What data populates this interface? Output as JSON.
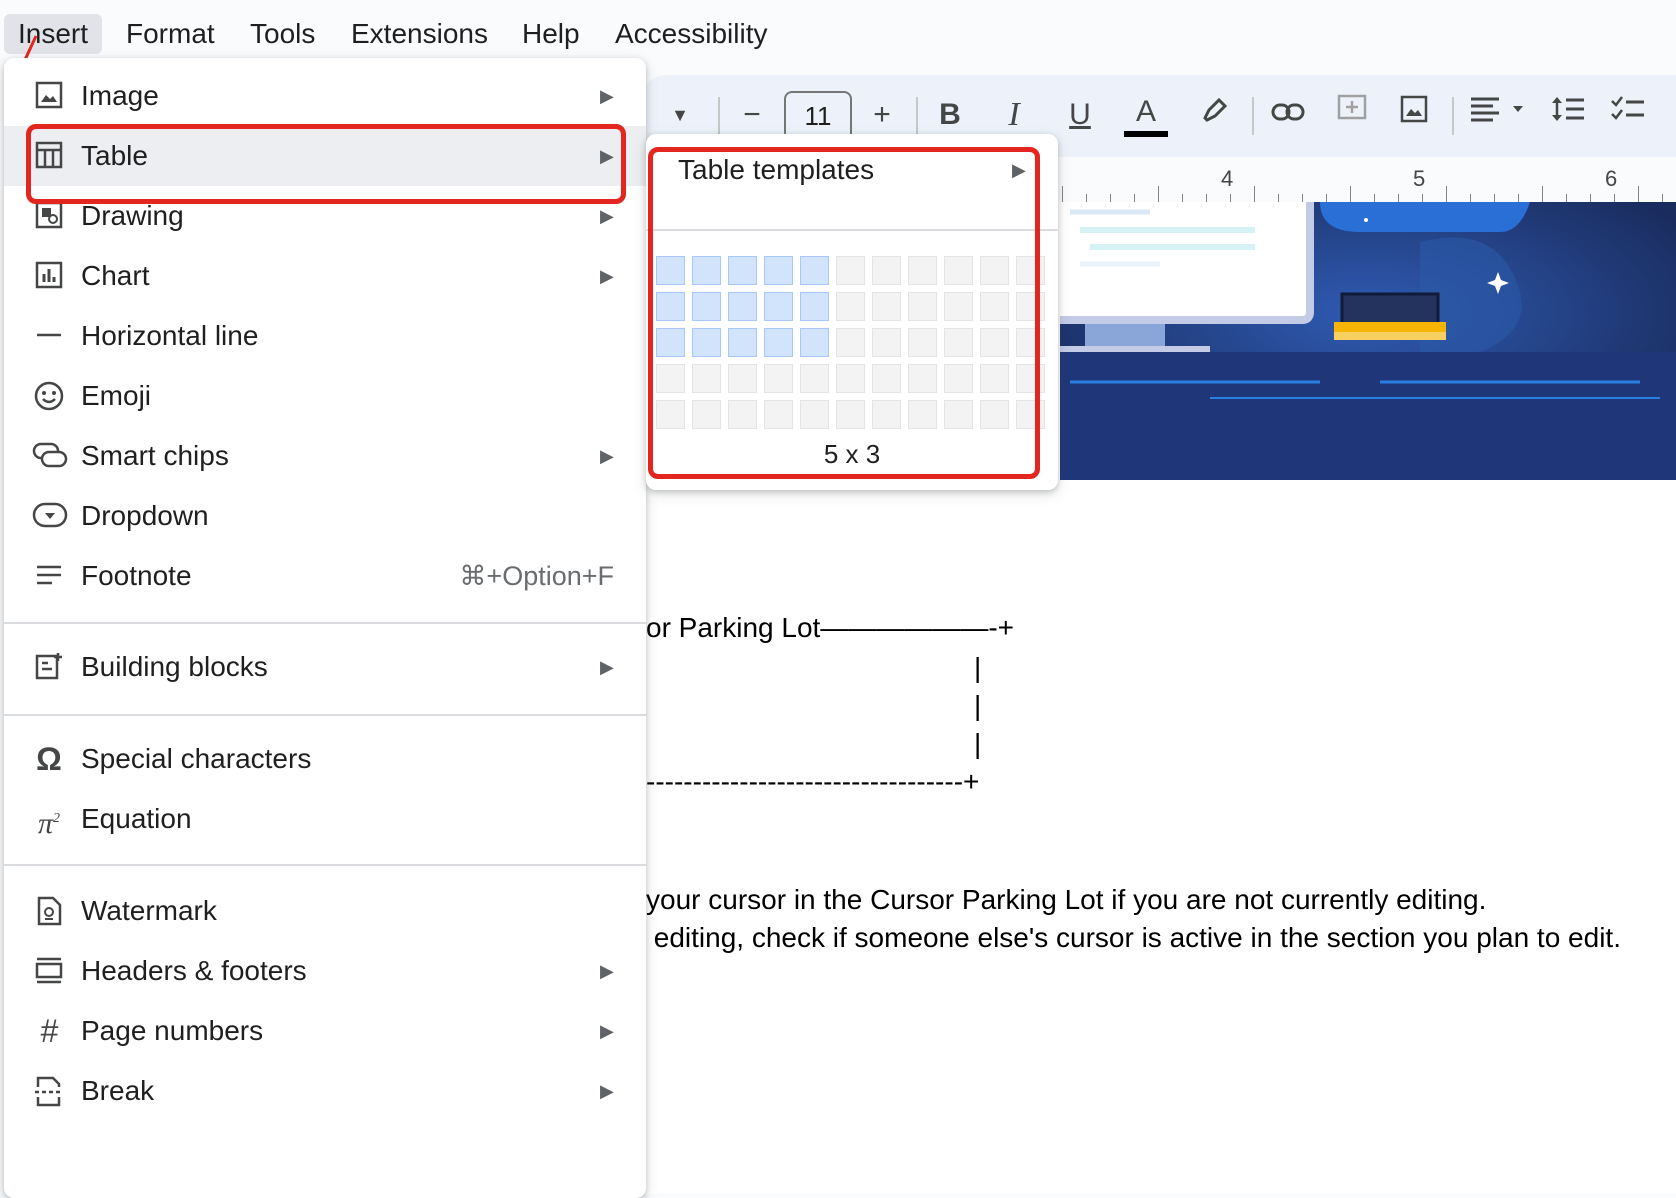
{
  "menubar": {
    "items": [
      "Insert",
      "Format",
      "Tools",
      "Extensions",
      "Help",
      "Accessibility"
    ]
  },
  "toolbar": {
    "font_size": "11",
    "minus_label": "−",
    "plus_label": "+",
    "bold_label": "B",
    "italic_label": "I",
    "underline_label": "U",
    "text_color_label": "A",
    "text_color_accent": "#000000"
  },
  "ruler": {
    "numbers": [
      "4",
      "5",
      "6"
    ]
  },
  "insert_menu": {
    "group1": [
      {
        "label": "Image",
        "icon": "image-icon",
        "arrow": true
      },
      {
        "label": "Table",
        "icon": "table-icon",
        "arrow": true
      },
      {
        "label": "Drawing",
        "icon": "drawing-icon",
        "arrow": true
      },
      {
        "label": "Chart",
        "icon": "chart-icon",
        "arrow": true
      },
      {
        "label": "Horizontal line",
        "icon": "horizontal-line-icon",
        "arrow": false
      },
      {
        "label": "Emoji",
        "icon": "emoji-icon",
        "arrow": false
      },
      {
        "label": "Smart chips",
        "icon": "smart-chips-icon",
        "arrow": true
      },
      {
        "label": "Dropdown",
        "icon": "dropdown-icon",
        "arrow": false
      },
      {
        "label": "Footnote",
        "icon": "footnote-icon",
        "arrow": false,
        "shortcut": "⌘+Option+F"
      }
    ],
    "group2": [
      {
        "label": "Building blocks",
        "icon": "building-blocks-icon",
        "arrow": true
      }
    ],
    "group3": [
      {
        "label": "Special characters",
        "icon": "omega-icon",
        "arrow": false
      },
      {
        "label": "Equation",
        "icon": "pi-icon",
        "arrow": false
      }
    ],
    "group4": [
      {
        "label": "Watermark",
        "icon": "watermark-icon",
        "arrow": false
      },
      {
        "label": "Headers & footers",
        "icon": "headers-footers-icon",
        "arrow": true
      },
      {
        "label": "Page numbers",
        "icon": "hash-icon",
        "arrow": true
      },
      {
        "label": "Break",
        "icon": "break-icon",
        "arrow": true
      }
    ],
    "arrow_glyph": "▶",
    "highlight_color": "#e3261f"
  },
  "table_submenu": {
    "templates_label": "Table templates",
    "grid_size_label": "5 x 3",
    "selected_cols": 5,
    "selected_rows": 3,
    "total_cols": 11,
    "total_rows": 5
  },
  "document": {
    "line1": "or Parking Lot——————-+",
    "bar": "|",
    "line2": "----------------------------------+",
    "para1": "your cursor in the Cursor Parking Lot if you are not currently editing.",
    "para2": " editing, check if someone else's cursor is active in the section you plan to edit."
  }
}
